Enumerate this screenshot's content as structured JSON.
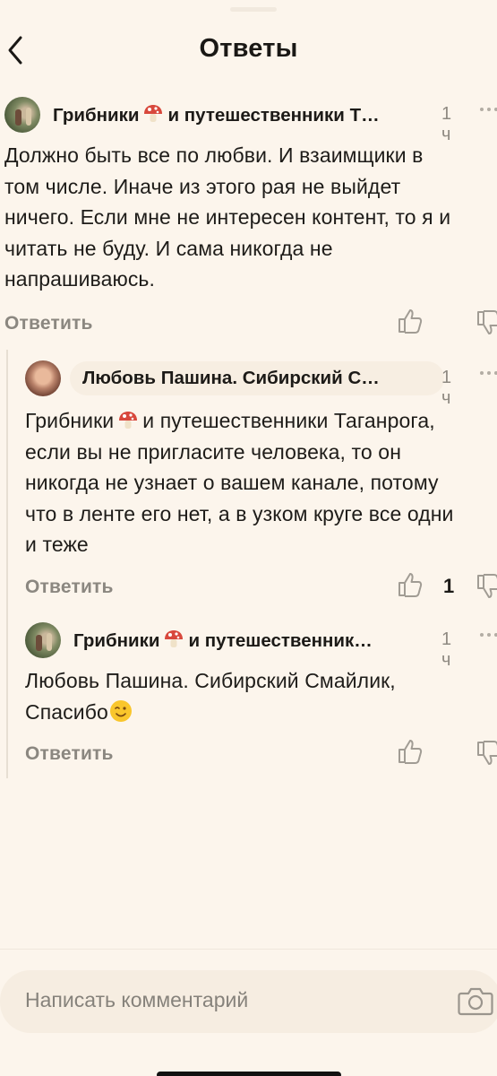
{
  "header": {
    "title": "Ответы"
  },
  "comments": [
    {
      "author_prefix": "Грибники",
      "author_suffix": "и путешественники Т…",
      "time": "1 ч",
      "text": "Должно быть все по любви. И взаимщики в\nтом числе. Иначе из этого рая не выйдет\nничего. Если мне не интересен контент, то я и\nчитать не буду. И сама никогда не\nнапрашиваюсь.",
      "reply_label": "Ответить",
      "likes": ""
    },
    {
      "author": "Любовь Пашина. Сибирский С…",
      "time": "1 ч",
      "text_prefix": "Грибники",
      "text": "и путешественники Таганрога,\nесли вы не пригласите человека, то он\nникогда не узнает о вашем канале, потому\nчто в ленте его нет, а в узком круге все одни\nи теже",
      "reply_label": "Ответить",
      "likes": "1"
    },
    {
      "author_prefix": "Грибники",
      "author_suffix": "и путешественник…",
      "time": "1 ч",
      "text": "Любовь Пашина. Сибирский Смайлик,\nСпасибо",
      "emoji": "wink-emoji",
      "reply_label": "Ответить",
      "likes": ""
    }
  ],
  "composer": {
    "placeholder": "Написать комментарий"
  },
  "icons": [
    "back-arrow-icon",
    "mushroom-icon",
    "more-icon",
    "thumb-up-icon",
    "thumb-down-icon",
    "camera-icon",
    "wink-emoji-icon"
  ],
  "colors": {
    "background": "#fcf5ec",
    "muted_text": "#8b8780",
    "pill": "#f7eee2"
  }
}
